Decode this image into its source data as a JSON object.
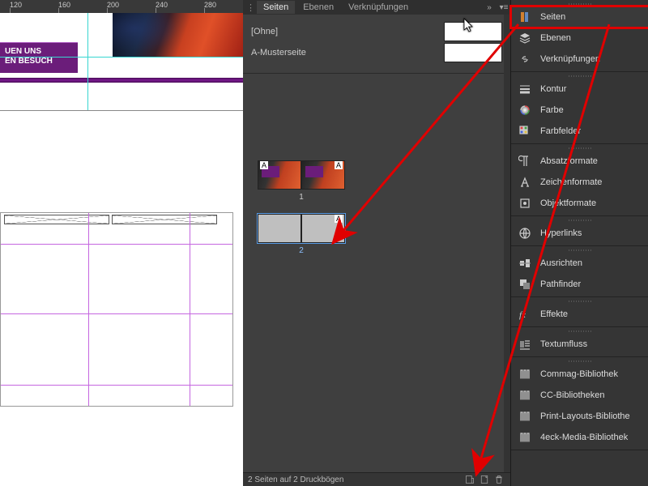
{
  "ruler": {
    "ticks": [
      120,
      160,
      200,
      240,
      280
    ]
  },
  "layout": {
    "banner_line1": "UEN UNS",
    "banner_line2": "EN BESUCH"
  },
  "pages_panel": {
    "tabs": [
      "Seiten",
      "Ebenen",
      "Verknüpfungen"
    ],
    "active_tab": 0,
    "masters": [
      {
        "label": "[Ohne]"
      },
      {
        "label": "A-Musterseite"
      }
    ],
    "spreads": [
      {
        "num": "1",
        "master_left": "A",
        "master_right": "A",
        "has_image": true
      },
      {
        "num": "2",
        "master_right": "A",
        "selected": true
      }
    ],
    "status": "2 Seiten auf 2 Druckbögen"
  },
  "dock": [
    {
      "group": [
        {
          "name": "seiten",
          "label": "Seiten",
          "highlight": true
        },
        {
          "name": "ebenen",
          "label": "Ebenen"
        },
        {
          "name": "verknuepfungen",
          "label": "Verknüpfungen"
        }
      ]
    },
    {
      "group": [
        {
          "name": "kontur",
          "label": "Kontur"
        },
        {
          "name": "farbe",
          "label": "Farbe"
        },
        {
          "name": "farbfelder",
          "label": "Farbfelder"
        }
      ]
    },
    {
      "group": [
        {
          "name": "absatzformate",
          "label": "Absatzformate"
        },
        {
          "name": "zeichenformate",
          "label": "Zeichenformate"
        },
        {
          "name": "objektformate",
          "label": "Objektformate"
        }
      ]
    },
    {
      "group": [
        {
          "name": "hyperlinks",
          "label": "Hyperlinks"
        }
      ]
    },
    {
      "group": [
        {
          "name": "ausrichten",
          "label": "Ausrichten"
        },
        {
          "name": "pathfinder",
          "label": "Pathfinder"
        }
      ]
    },
    {
      "group": [
        {
          "name": "effekte",
          "label": "Effekte"
        }
      ]
    },
    {
      "group": [
        {
          "name": "textumfluss",
          "label": "Textumfluss"
        }
      ]
    },
    {
      "group": [
        {
          "name": "commag-bib",
          "label": "Commag-Bibliothek"
        },
        {
          "name": "cc-bib",
          "label": "CC-Bibliotheken"
        },
        {
          "name": "print-bib",
          "label": "Print-Layouts-Bibliothe"
        },
        {
          "name": "4eck-bib",
          "label": "4eck-Media-Bibliothek"
        }
      ]
    }
  ]
}
